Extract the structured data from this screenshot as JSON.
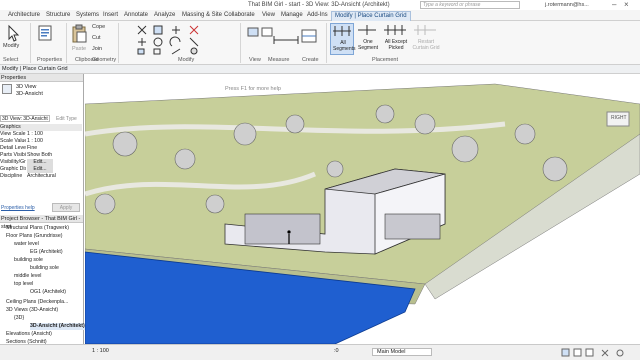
{
  "title": {
    "text": "That BIM Girl - start - 3D View: 3D-Ansicht (Architekt)",
    "search_placeholder": "Type a keyword or phrase",
    "user": "j.rotermann@hs..."
  },
  "tabs": [
    "Architecture",
    "Structure",
    "Systems",
    "Insert",
    "Annotate",
    "Analyze",
    "Massing & Site",
    "Collaborate",
    "View",
    "Manage",
    "Add-Ins",
    "Modify | Place Curtain Grid"
  ],
  "ribbon": {
    "modify_label": "Modify",
    "properties_label": "Properties",
    "clipboard_items": [
      "Paste",
      "Cope",
      "Cut",
      "Join"
    ],
    "geometry_label": "Geometry",
    "clipboard_label": "Clipboard",
    "modify_panel_label": "Modify",
    "view_label": "View",
    "measure_label": "Measure",
    "create_label": "Create",
    "placement_label": "Placement",
    "placement_buttons": [
      "All Segments",
      "One Segment",
      "All Except Picked",
      "Restart Curtain Grid"
    ],
    "select_label": "Select"
  },
  "optbar": {
    "text": "Modify | Place Curtain Grid"
  },
  "properties": {
    "header": "Properties",
    "type_name": "3D View",
    "type_sub": "3D-Ansicht",
    "selector": "3D View: 3D-Ansicht",
    "edit_type": "Edit Type",
    "rows": [
      {
        "k": "Graphics",
        "v": ""
      },
      {
        "k": "View Scale",
        "v": "1 : 100"
      },
      {
        "k": "Scale Value",
        "v": "1 : 100"
      },
      {
        "k": "Detail Level",
        "v": "Fine"
      },
      {
        "k": "Parts Visibility",
        "v": "Show Both"
      },
      {
        "k": "Visibility/Grap...",
        "v": "Edit..."
      },
      {
        "k": "Graphic Displa...",
        "v": "Edit..."
      },
      {
        "k": "Discipline",
        "v": "Architectural"
      }
    ],
    "help": "Properties help",
    "apply": "Apply"
  },
  "browser": {
    "header": "Project Browser - That BIM Girl - start",
    "items": [
      {
        "label": "Structural Plans (Tragwerk)",
        "indent": 1
      },
      {
        "label": "Floor Plans (Grundrisse)",
        "indent": 1
      },
      {
        "label": "water level",
        "indent": 2
      },
      {
        "label": "EG (Architekt)",
        "indent": 3
      },
      {
        "label": "building sole",
        "indent": 2
      },
      {
        "label": "building sole",
        "indent": 3
      },
      {
        "label": "middle level",
        "indent": 2
      },
      {
        "label": "top level",
        "indent": 2
      },
      {
        "label": "OG1 (Architekt)",
        "indent": 3
      },
      {
        "label": "Ceiling Plans (Deckenpla...",
        "indent": 1
      },
      {
        "label": "3D Views (3D-Ansicht)",
        "indent": 1
      },
      {
        "label": "{3D}",
        "indent": 2
      },
      {
        "label": "3D-Ansicht (Architekt)",
        "indent": 3
      },
      {
        "label": "Elevations (Ansicht)",
        "indent": 1
      },
      {
        "label": "Sections (Schnitt)",
        "indent": 1
      }
    ]
  },
  "viewport": {
    "tooltip": "Press F1 for more help",
    "viewcube": "RIGHT"
  },
  "status": {
    "scale": "1 : 100",
    "model": "Main Model",
    "zero": ":0"
  }
}
